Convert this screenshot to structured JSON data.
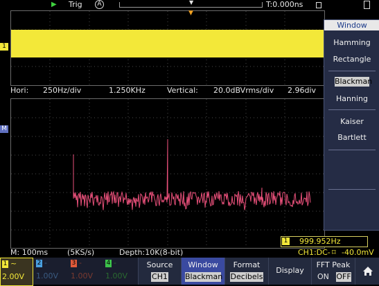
{
  "top": {
    "trig_label": "Trig",
    "trig_mode": "A",
    "trig_time": "T:0.000ns"
  },
  "info": {
    "hori_label": "Hori:",
    "hori_value": "250Hz/div",
    "center_freq": "1.250KHz",
    "vertical_label": "Vertical:",
    "vertical_value": "20.0dBVrms/div",
    "vertical_offset": "2.96div"
  },
  "markers": {
    "ch1": "1",
    "math": "M"
  },
  "status": {
    "timebase": "M: 100ms",
    "sample_rate": "(5KS/s)",
    "depth": "Depth:10K(8-bit)",
    "trigger": "CH1:DC-",
    "trigger_level": "-40.0mV",
    "freq_counter": "999.952Hz",
    "freq_ch": "1"
  },
  "channels": [
    {
      "num": "1",
      "wave": "~",
      "volt": "2.00V",
      "color": "#f3e839"
    },
    {
      "num": "2",
      "wave": "-",
      "volt": "1.00V",
      "color": "#4aa0e0"
    },
    {
      "num": "3",
      "wave": "-",
      "volt": "1.00V",
      "color": "#e05a3a"
    },
    {
      "num": "4",
      "wave": "-",
      "volt": "1.00V",
      "color": "#3cc24a"
    }
  ],
  "menu": {
    "source_label": "Source",
    "source_value": "CH1",
    "window_label": "Window",
    "window_value": "Blackman",
    "format_label": "Format",
    "format_value": "Decibels",
    "display_label": "Display",
    "fft_peak_label": "FFT Peak",
    "fft_on": "ON",
    "fft_off": "OFF"
  },
  "window_menu": {
    "title": "Window",
    "items": [
      "Hamming",
      "Rectangle",
      "Blackman",
      "Hanning",
      "Kaiser",
      "Bartlett"
    ],
    "selected": "Blackman"
  },
  "colors": {
    "ch1": "#f3e839",
    "fft_trace": "#e8507a",
    "menu_bg": "#252c45",
    "grid": "#5a5a5a"
  },
  "icons": [
    "play-icon",
    "auto-mode-icon",
    "trigger-position-icon",
    "lock-icon",
    "battery-icon",
    "home-icon"
  ]
}
